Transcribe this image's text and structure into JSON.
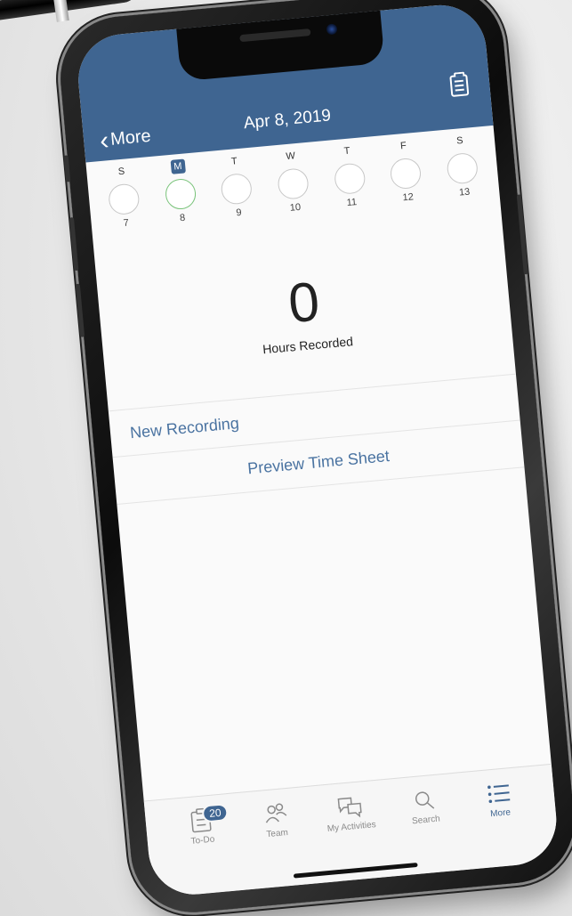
{
  "nav": {
    "back_label": "More",
    "title": "Apr 8, 2019"
  },
  "week": [
    {
      "dow": "S",
      "num": "7",
      "selected": false
    },
    {
      "dow": "M",
      "num": "8",
      "selected": true
    },
    {
      "dow": "T",
      "num": "9",
      "selected": false
    },
    {
      "dow": "W",
      "num": "10",
      "selected": false
    },
    {
      "dow": "T",
      "num": "11",
      "selected": false
    },
    {
      "dow": "F",
      "num": "12",
      "selected": false
    },
    {
      "dow": "S",
      "num": "13",
      "selected": false
    }
  ],
  "summary": {
    "hours": "0",
    "label": "Hours Recorded"
  },
  "actions": {
    "new_recording": "New Recording",
    "preview_time_sheet": "Preview Time Sheet"
  },
  "tabs": [
    {
      "label": "To-Do",
      "icon": "clipboard-icon",
      "badge": "20"
    },
    {
      "label": "Team",
      "icon": "team-icon"
    },
    {
      "label": "My Activities",
      "icon": "chat-bubbles-icon"
    },
    {
      "label": "Search",
      "icon": "search-icon"
    },
    {
      "label": "More",
      "icon": "list-icon",
      "active": true
    }
  ],
  "colors": {
    "accent": "#3f6591",
    "link": "#4a73a1",
    "today_ring": "#79c37a"
  }
}
